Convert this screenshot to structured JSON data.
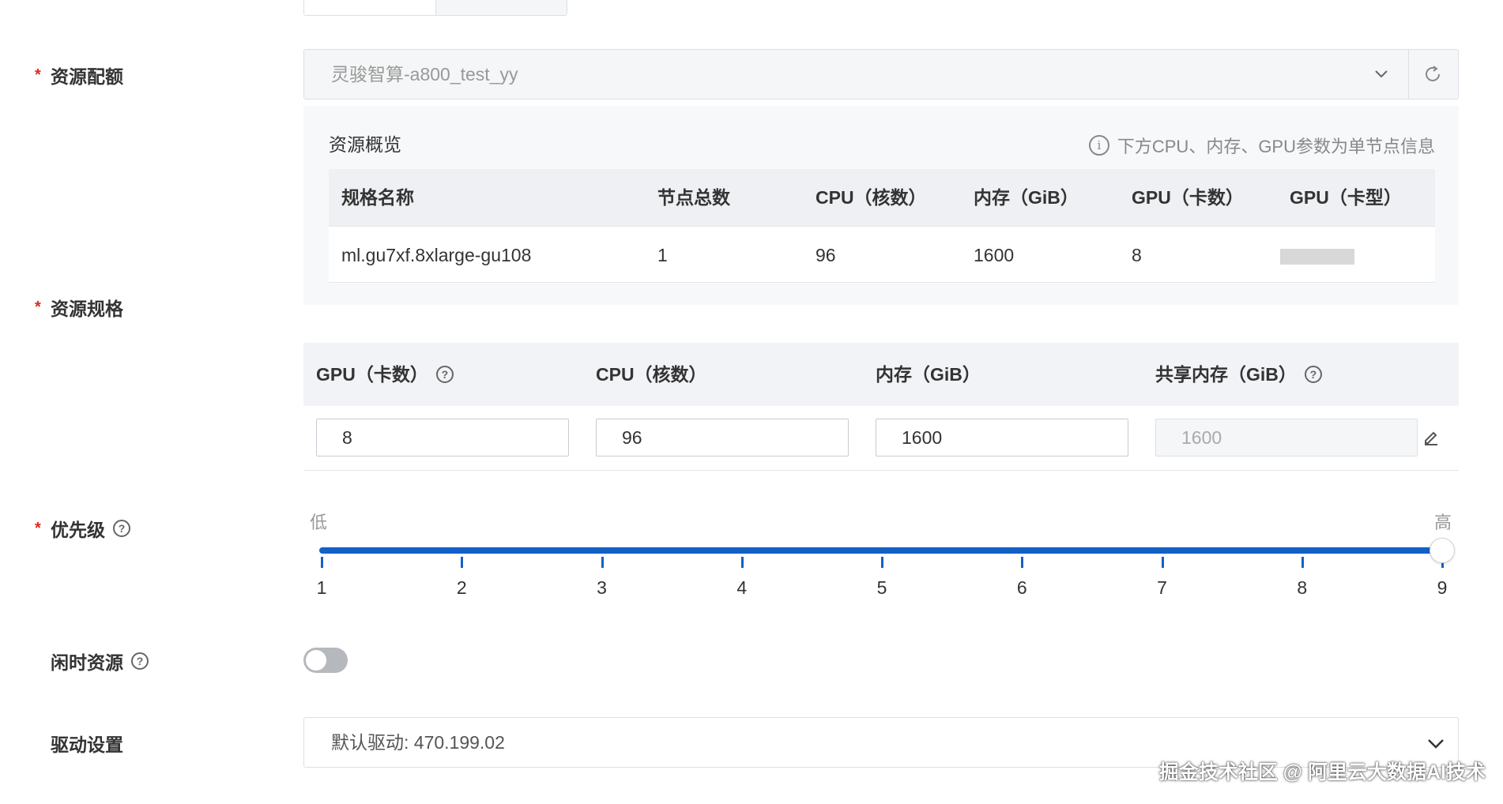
{
  "quota": {
    "label": "资源配额",
    "selected": "灵骏智算-a800_test_yy",
    "overview_title": "资源概览",
    "overview_info": "下方CPU、内存、GPU参数为单节点信息",
    "table": {
      "headers": [
        "规格名称",
        "节点总数",
        "CPU（核数）",
        "内存（GiB）",
        "GPU（卡数）",
        "GPU（卡型）"
      ],
      "rows": [
        [
          "ml.gu7xf.8xlarge-gu108",
          "1",
          "96",
          "1600",
          "8",
          ""
        ]
      ]
    }
  },
  "spec": {
    "label": "资源规格",
    "headers": [
      "GPU（卡数）",
      "CPU（核数）",
      "内存（GiB）",
      "共享内存（GiB）"
    ],
    "values": [
      "8",
      "96",
      "1600",
      "1600"
    ]
  },
  "priority": {
    "label": "优先级",
    "low": "低",
    "high": "高",
    "ticks": [
      "1",
      "2",
      "3",
      "4",
      "5",
      "6",
      "7",
      "8",
      "9"
    ],
    "value": 9
  },
  "idle": {
    "label": "闲时资源",
    "enabled": false
  },
  "driver": {
    "label": "驱动设置",
    "selected": "默认驱动: 470.199.02"
  },
  "watermark": "掘金技术社区 @ 阿里云大数据AI技术",
  "colors": {
    "accent": "#1460c8",
    "required": "#e0281c"
  }
}
